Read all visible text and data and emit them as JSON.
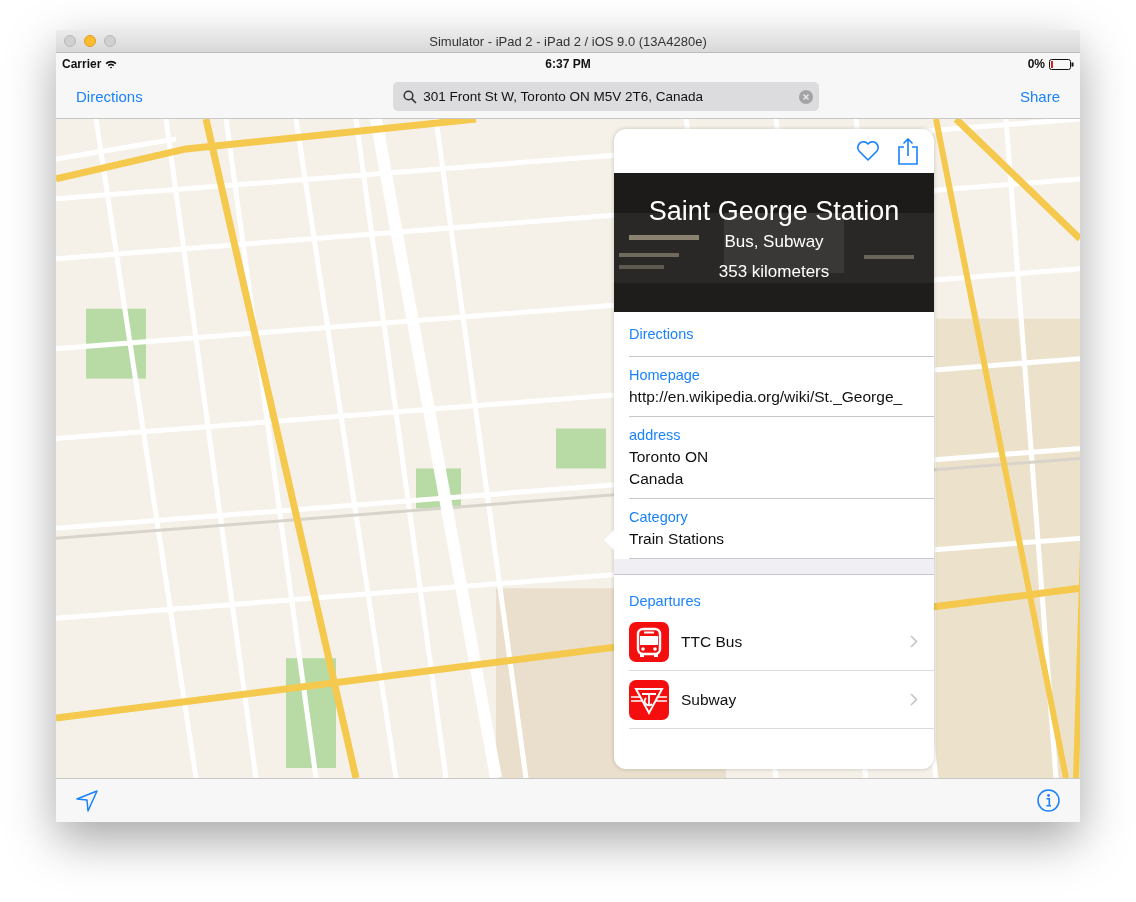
{
  "window": {
    "title": "Simulator - iPad 2 - iPad 2 / iOS 9.0 (13A4280e)"
  },
  "status_bar": {
    "carrier": "Carrier",
    "time": "6:37 PM",
    "battery": "0%"
  },
  "nav_bar": {
    "left_button": "Directions",
    "search": {
      "value": "301 Front St W, Toronto ON M5V 2T6, Canada"
    },
    "right_button": "Share"
  },
  "place_card": {
    "title": "Saint George Station",
    "subtitle": "Bus, Subway",
    "distance": "353 kilometers",
    "action": "Directions",
    "fields": [
      {
        "label": "Homepage",
        "lines": [
          "http://en.wikipedia.org/wiki/St._George_"
        ]
      },
      {
        "label": "address",
        "lines": [
          "Toronto ON",
          "Canada"
        ]
      },
      {
        "label": "Category",
        "lines": [
          "Train Stations"
        ]
      }
    ],
    "departures": {
      "heading": "Departures",
      "items": [
        {
          "name": "TTC Bus",
          "kind": "bus"
        },
        {
          "name": "Subway",
          "kind": "subway"
        }
      ]
    }
  }
}
